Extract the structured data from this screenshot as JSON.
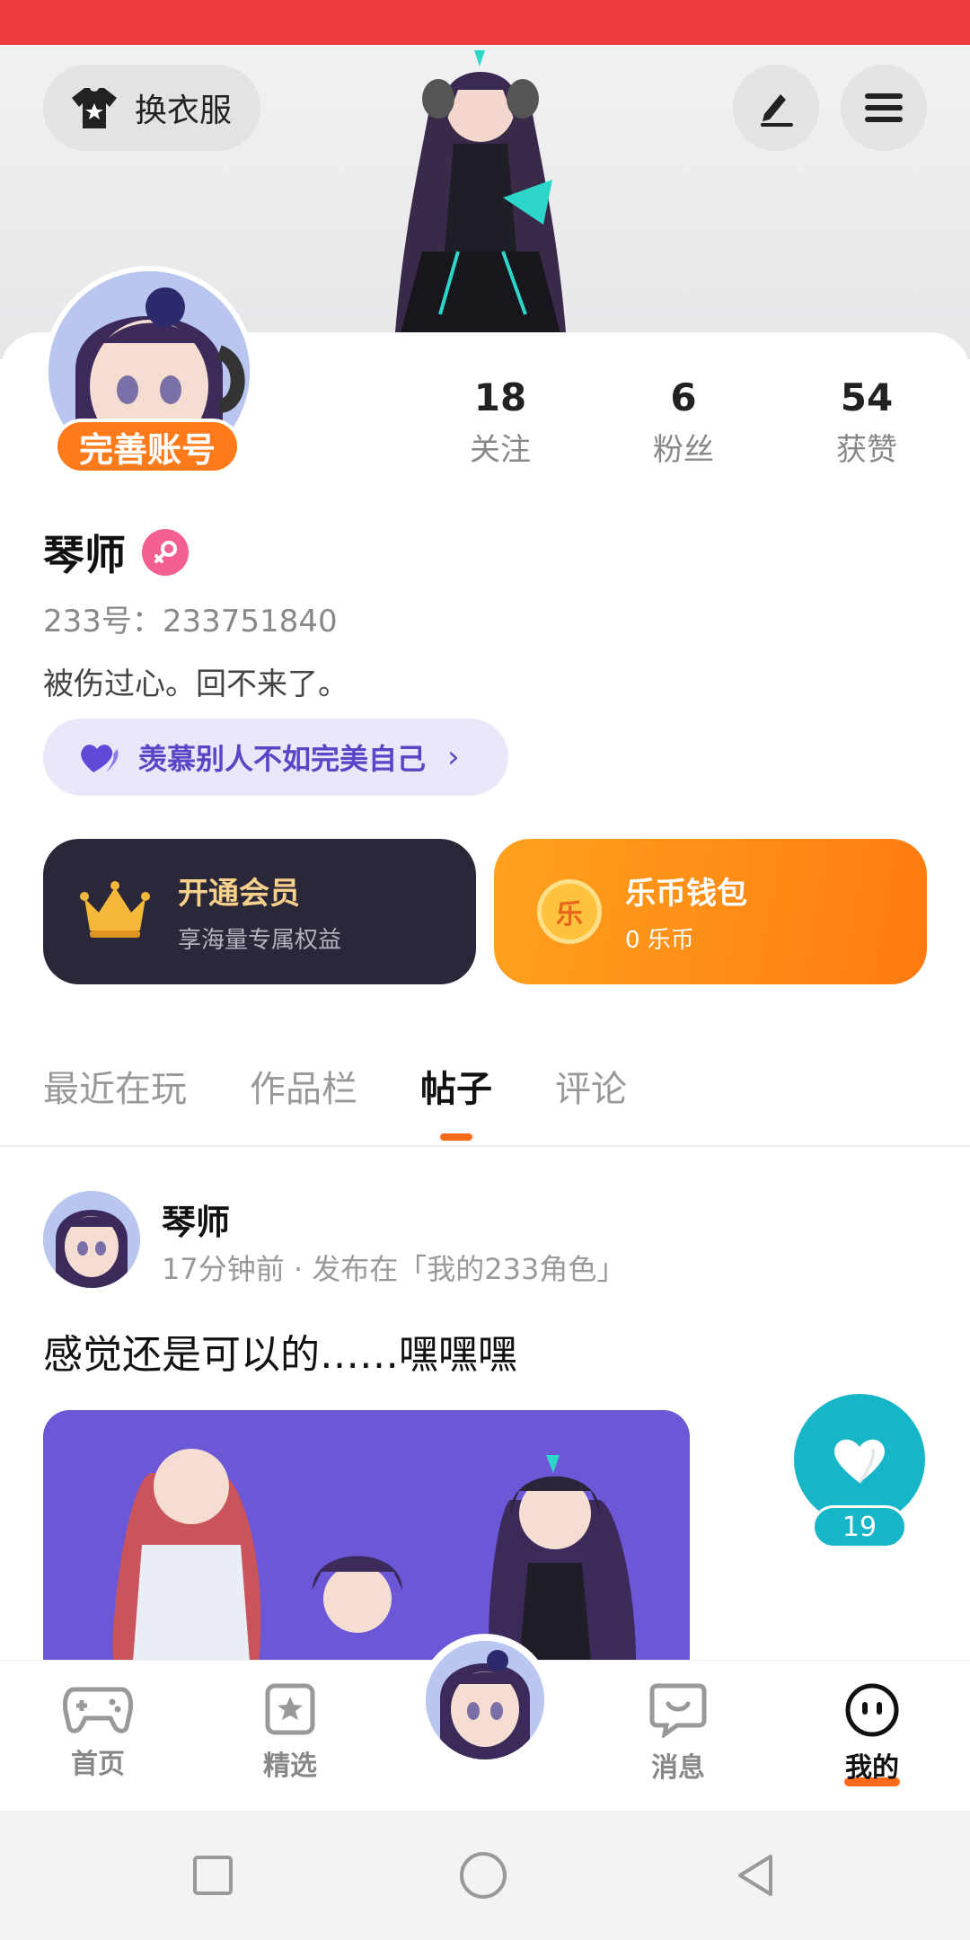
{
  "header": {
    "outfit_label": "换衣服",
    "accent_color": "#f03c3c"
  },
  "profile": {
    "complete_badge": "完善账号",
    "name": "琴师",
    "uid": "233号：233751840",
    "bio": "被伤过心。回不来了。",
    "tag_text": "羡慕别人不如完美自己",
    "stats": [
      {
        "value": "18",
        "label": "关注"
      },
      {
        "value": "6",
        "label": "粉丝"
      },
      {
        "value": "54",
        "label": "获赞"
      }
    ]
  },
  "cards": {
    "vip": {
      "title": "开通会员",
      "subtitle": "享海量专属权益"
    },
    "coin": {
      "title": "乐币钱包",
      "subtitle": "0 乐币",
      "icon_text": "乐"
    }
  },
  "tabs": [
    "最近在玩",
    "作品栏",
    "帖子",
    "评论"
  ],
  "post": {
    "author": "琴师",
    "meta": "17分钟前 · 发布在「我的233角色」",
    "text": "感觉还是可以的……嘿嘿嘿",
    "likes": "19"
  },
  "nav": {
    "items": [
      {
        "label": "首页",
        "icon": "gamepad-icon"
      },
      {
        "label": "精选",
        "icon": "star-bookmark-icon"
      },
      {
        "label": "消息",
        "icon": "chat-icon"
      },
      {
        "label": "我的",
        "icon": "smiley-icon"
      }
    ]
  }
}
